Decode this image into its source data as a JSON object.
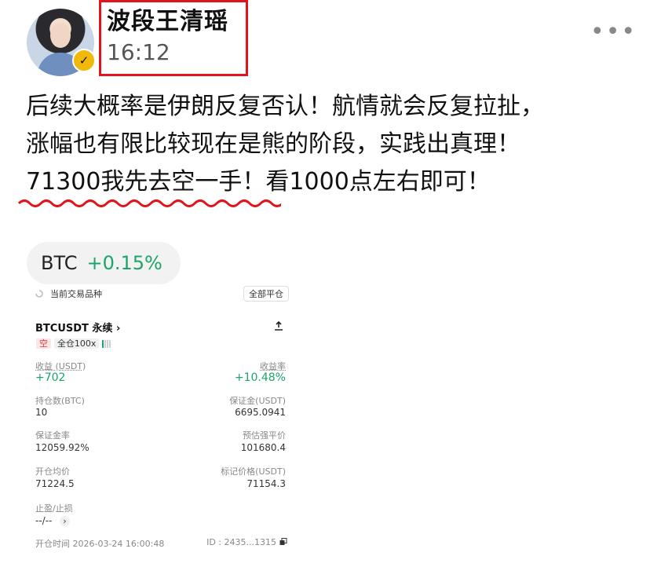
{
  "header": {
    "name": "波段王清瑶",
    "time": "16:12",
    "more_glyph": "•••"
  },
  "post": {
    "lines": [
      "后续大概率是伊朗反复否认！航情就会反复拉扯，",
      "涨幅也有限比较现在是熊的阶段，实践出真理！",
      "71300我先去空一手！看1000点左右即可！"
    ]
  },
  "ticker": {
    "symbol": "BTC",
    "change": "+0.15%"
  },
  "card": {
    "header_left": "当前交易品种",
    "header_right": "全部平仓",
    "pair": "BTCUSDT 永续",
    "pair_chevron": "›",
    "side": "空",
    "margin_mode": "全仓100x",
    "pnl_label": "收益 (USDT)",
    "pnl_value": "+702",
    "roi_label": "收益率",
    "roi_value": "+10.48%",
    "position_label": "持仓数(BTC)",
    "position_value": "10",
    "margin_label": "保证金(USDT)",
    "margin_value": "6695.0941",
    "margin_ratio_label": "保证金率",
    "margin_ratio_value": "12059.92%",
    "liq_label": "预估强平价",
    "liq_value": "101680.4",
    "entry_label": "开仓均价",
    "entry_value": "71224.5",
    "mark_label": "标记价格(USDT)",
    "mark_value": "71154.3",
    "tpsl_label": "止盈/止损",
    "tpsl_value": "--/--",
    "open_time": "开仓时间 2026-03-24 16:00:48",
    "id": "ID : 2435...1315"
  },
  "colors": {
    "highlight_box": "#e1141b",
    "positive": "#1aa56a",
    "brand_badge": "#f0b90b"
  },
  "icons": [
    "verified-badge-icon",
    "more-icon",
    "share-icon",
    "chevron-right-icon",
    "copy-icon",
    "leverage-bars-icon"
  ]
}
